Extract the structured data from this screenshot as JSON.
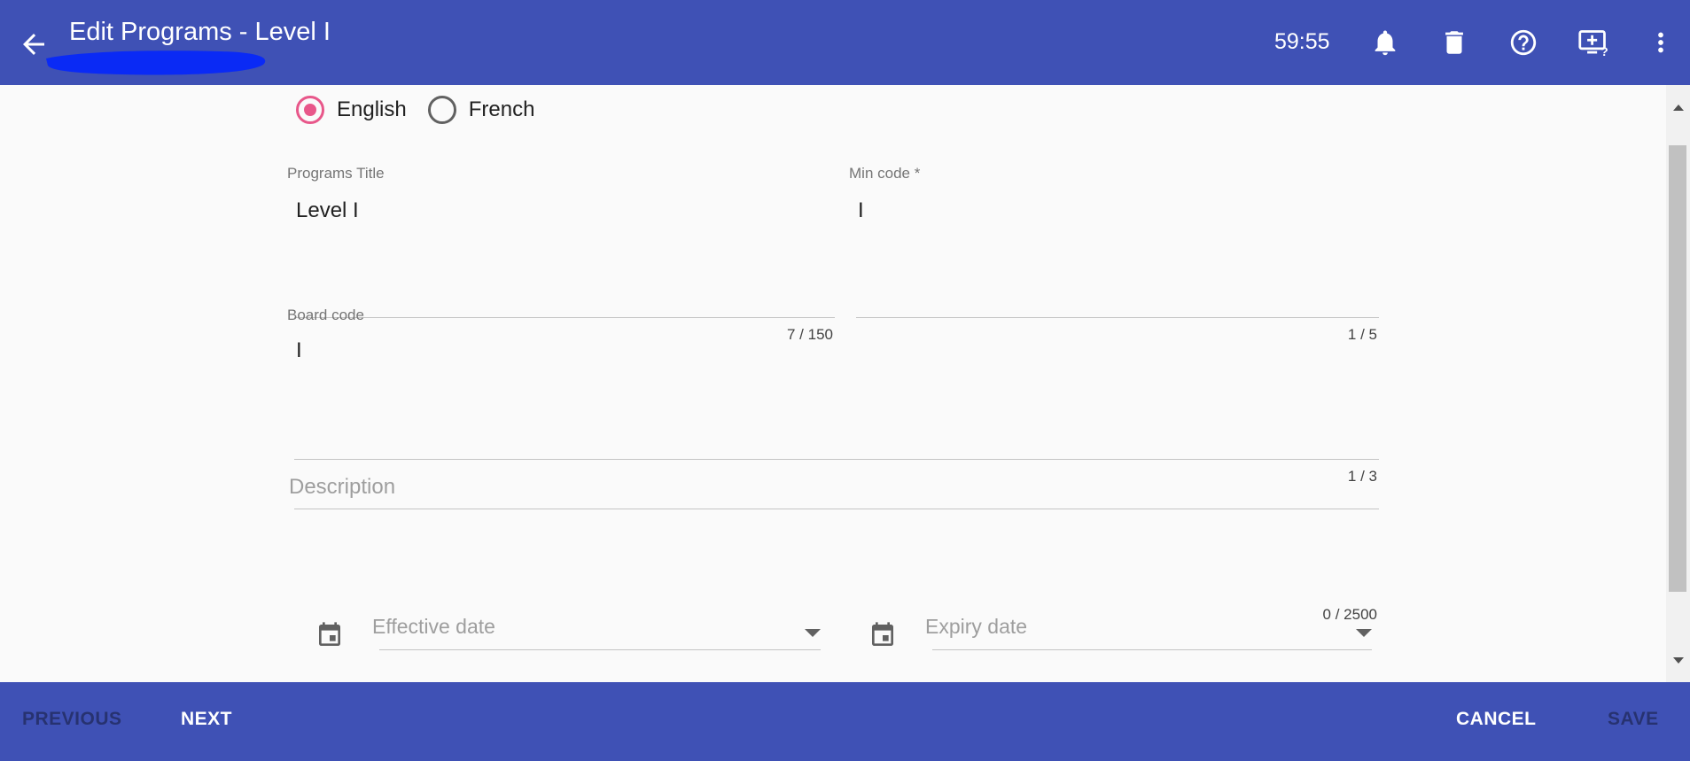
{
  "header": {
    "title": "Edit Programs - Level I",
    "timer": "59:55",
    "icons": [
      "arrow-back-icon",
      "bell-icon",
      "trash-icon",
      "help-icon",
      "screen-help-icon",
      "more-vert-icon"
    ]
  },
  "language": {
    "options": [
      {
        "label": "English",
        "selected": true
      },
      {
        "label": "French",
        "selected": false
      }
    ]
  },
  "form": {
    "programs_title": {
      "label": "Programs Title",
      "value": "Level I",
      "counter": "7 / 150"
    },
    "min_code": {
      "label": "Min code *",
      "value": "I",
      "counter": "1 / 5"
    },
    "board_code": {
      "label": "Board code",
      "value": "I",
      "counter": "1 / 3"
    },
    "description": {
      "placeholder": "Description",
      "counter": "0 / 2500"
    },
    "effective_date": {
      "placeholder": "Effective date"
    },
    "expiry_date": {
      "placeholder": "Expiry date"
    }
  },
  "footer": {
    "previous": "PREVIOUS",
    "next": "NEXT",
    "cancel": "CANCEL",
    "save": "SAVE"
  },
  "colors": {
    "primary": "#3f51b5",
    "accent": "#e8578a",
    "background": "#fafafa"
  }
}
